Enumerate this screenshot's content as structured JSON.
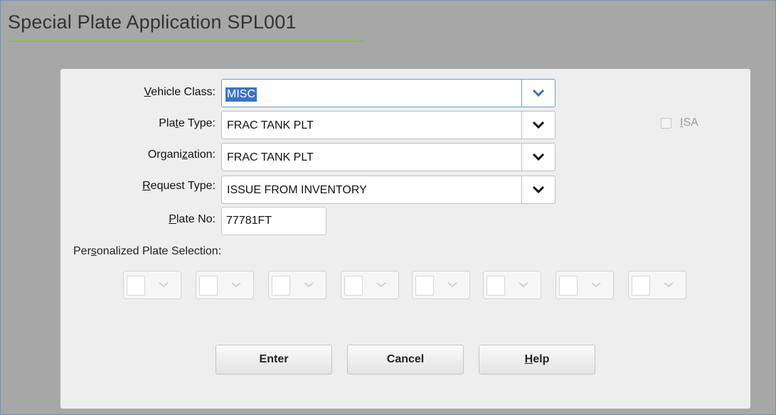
{
  "window": {
    "title": "Special Plate Application SPL001"
  },
  "form": {
    "vehicle_class": {
      "label_pre": "",
      "label_u": "V",
      "label_post": "ehicle Class:",
      "value": "MISC"
    },
    "plate_type": {
      "label_pre": "Pla",
      "label_u": "t",
      "label_post": "e Type:",
      "value": "FRAC TANK PLT"
    },
    "organization": {
      "label_pre": "Organi",
      "label_u": "z",
      "label_post": "ation:",
      "value": "FRAC TANK PLT"
    },
    "request_type": {
      "label_pre": "",
      "label_u": "R",
      "label_post": "equest Type:",
      "value": "ISSUE FROM INVENTORY"
    },
    "plate_no": {
      "label_pre": "",
      "label_u": "P",
      "label_post": "late No:",
      "value": "77781FT"
    },
    "isa": {
      "label_pre": "",
      "label_u": "I",
      "label_post": "SA",
      "checked": false
    },
    "personalized": {
      "label_pre": "Per",
      "label_u": "s",
      "label_post": "onalized Plate Selection:",
      "count": 8
    }
  },
  "buttons": {
    "enter": "Enter",
    "cancel": "Cancel",
    "help_u": "H",
    "help_rest": "elp"
  },
  "colors": {
    "accent_underline": "#7fc241",
    "selection": "#3b73c4",
    "focus_border": "#6b9ad8"
  },
  "icons": {
    "dropdown": "chevron-down-icon"
  }
}
